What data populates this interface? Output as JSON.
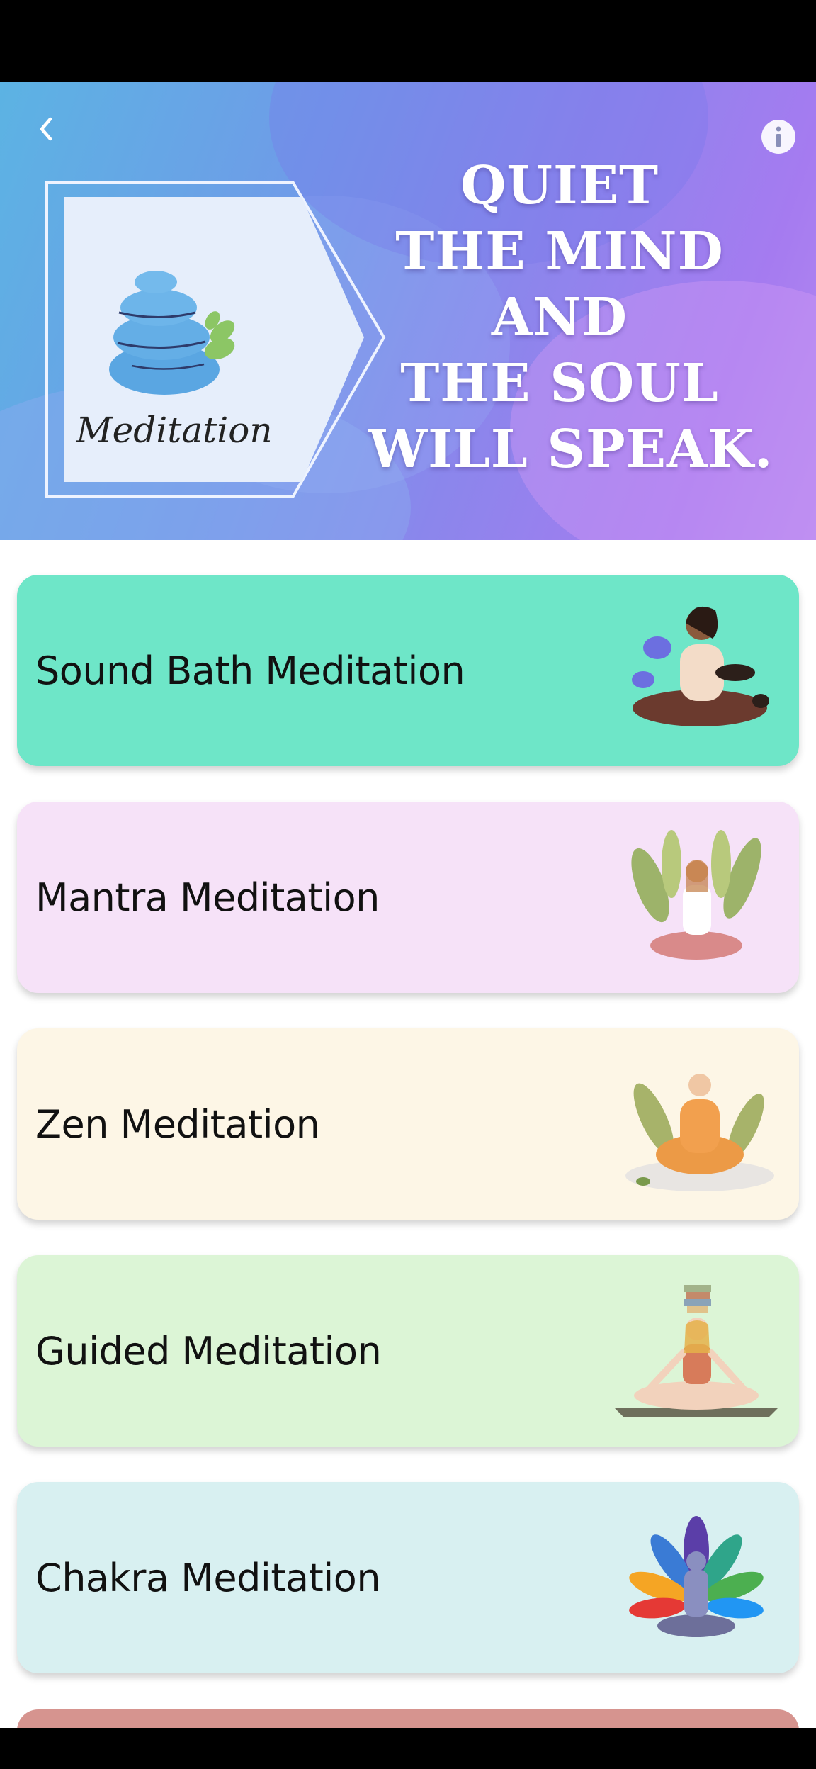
{
  "header": {
    "back_icon": "chevron-left-icon",
    "info_icon": "info-icon",
    "logo_text": "Meditation",
    "quote_lines": [
      "QUIET",
      "THE MIND",
      "AND",
      "THE SOUL",
      "WILL SPEAK."
    ]
  },
  "cards": [
    {
      "label": "Sound Bath Meditation",
      "color": "#6ee6c8",
      "illustration": "sound-bath-illustration"
    },
    {
      "label": "Mantra Meditation",
      "color": "#f6e2f8",
      "illustration": "mantra-illustration"
    },
    {
      "label": "Zen Meditation",
      "color": "#fdf6e6",
      "illustration": "zen-illustration"
    },
    {
      "label": "Guided Meditation",
      "color": "#dcf5d6",
      "illustration": "guided-illustration"
    },
    {
      "label": "Chakra Meditation",
      "color": "#d8f0f1",
      "illustration": "chakra-illustration"
    }
  ],
  "partial_card_color": "#d6948f"
}
